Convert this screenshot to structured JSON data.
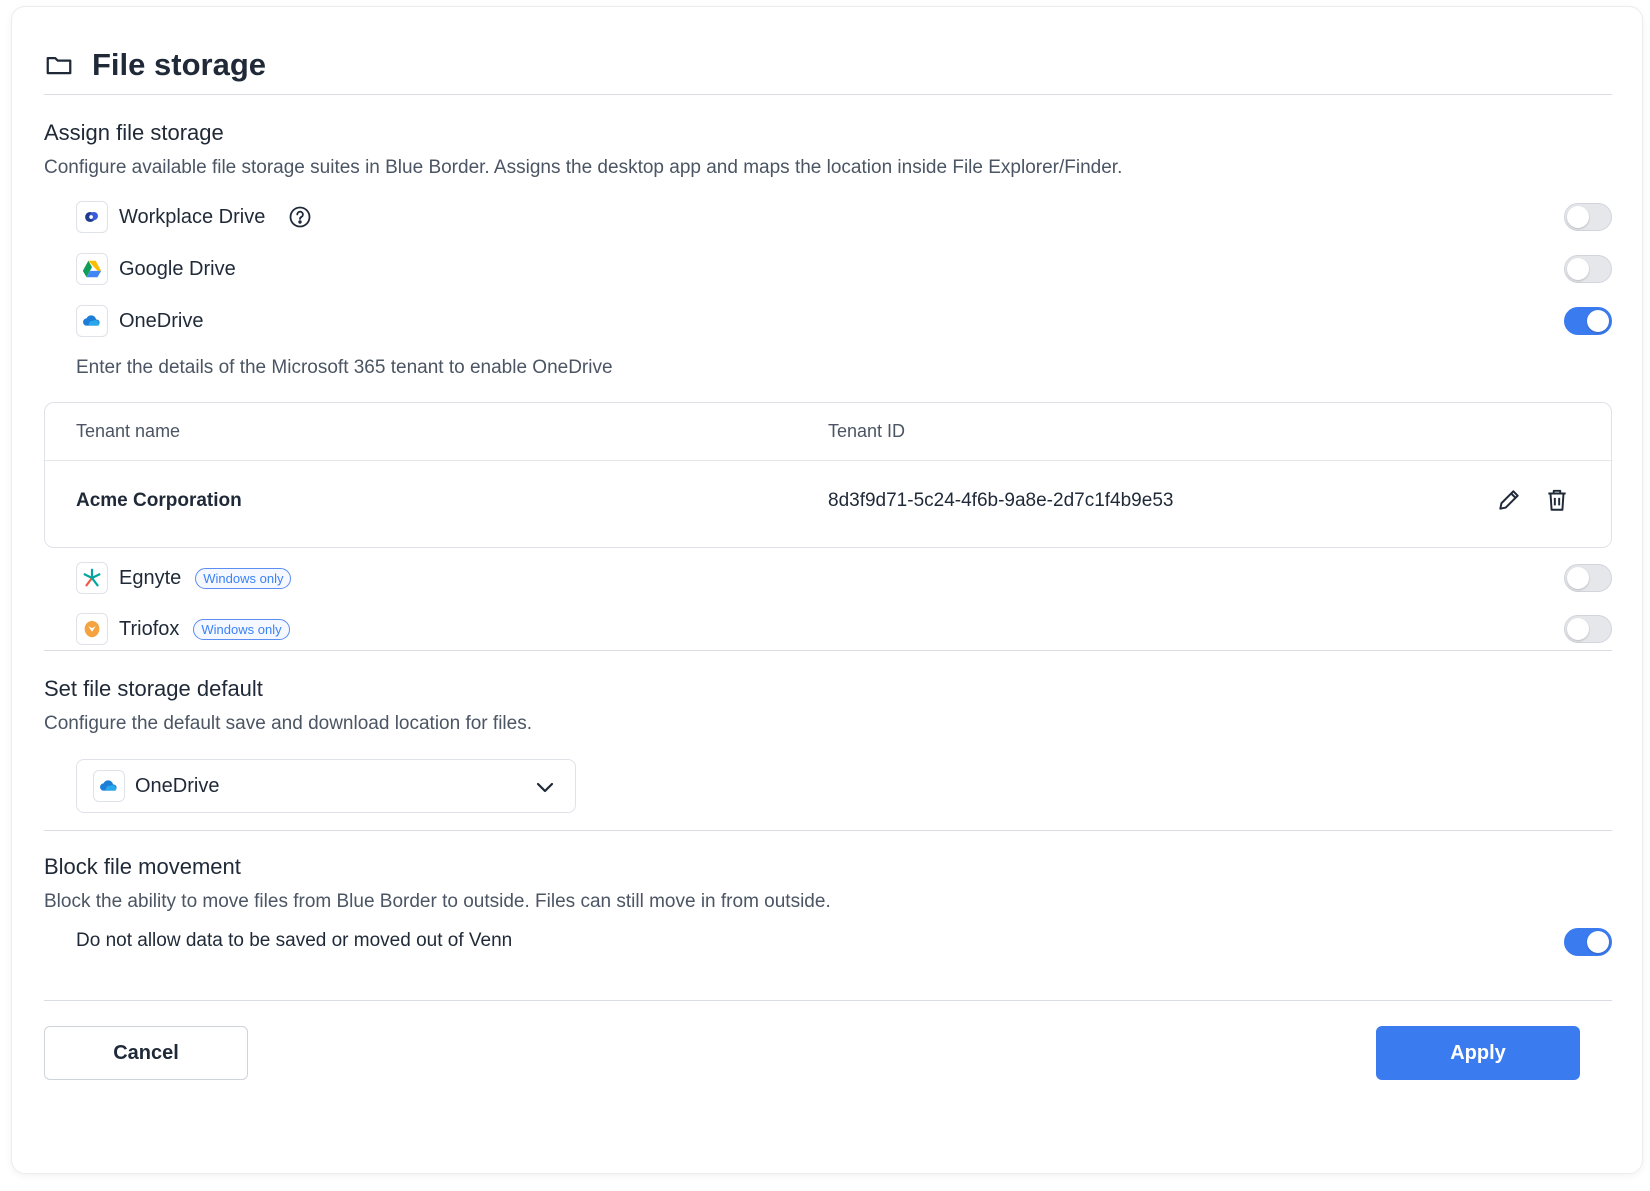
{
  "header": {
    "title": "File storage",
    "icon": "folder-icon"
  },
  "assign": {
    "title": "Assign file storage",
    "description": "Configure available file storage suites in Blue Border. Assigns the desktop app and maps the location inside File Explorer/Finder.",
    "providers": [
      {
        "name": "Workplace Drive",
        "icon": "workplace-drive-icon",
        "enabled": false,
        "has_help": true
      },
      {
        "name": "Google Drive",
        "icon": "google-drive-icon",
        "enabled": false
      },
      {
        "name": "OneDrive",
        "icon": "onedrive-icon",
        "enabled": true
      }
    ],
    "onedrive_hint": "Enter the details of the Microsoft 365 tenant to enable OneDrive",
    "tenant_table": {
      "headers": [
        "Tenant name",
        "Tenant ID"
      ],
      "rows": [
        {
          "name": "Acme Corporation",
          "id": "8d3f9d71-5c24-4f6b-9a8e-2d7c1f4b9e53"
        }
      ]
    },
    "windows_providers": [
      {
        "name": "Egnyte",
        "icon": "egnyte-icon",
        "badge": "Windows only",
        "enabled": false
      },
      {
        "name": "Triofox",
        "icon": "triofox-icon",
        "badge": "Windows only",
        "enabled": false
      }
    ]
  },
  "default": {
    "title": "Set file storage default",
    "description": "Configure the default save and download location for files.",
    "selected": "OneDrive"
  },
  "block": {
    "title": "Block file movement",
    "description": "Block the ability to move files from Blue Border to outside.  Files can still move in from outside.",
    "option_label": "Do not allow data to be saved or moved out of Venn",
    "enabled": true
  },
  "footer": {
    "cancel_label": "Cancel",
    "apply_label": "Apply"
  },
  "colors": {
    "accent": "#3b7bf0",
    "toggle_off": "#e5e7eb",
    "badge": "#3b82f6"
  }
}
